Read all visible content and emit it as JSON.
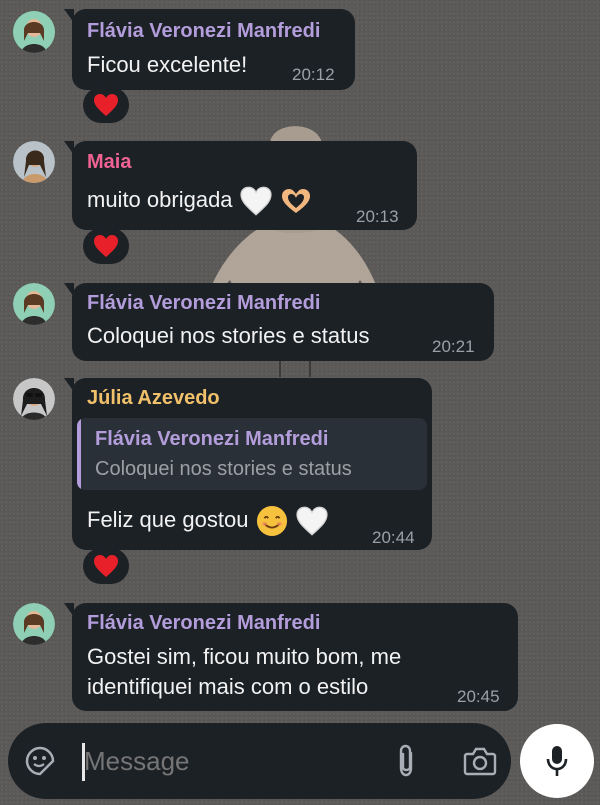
{
  "colors": {
    "bubble": "#1c2126",
    "name_purple": "#b39ddb",
    "name_pink": "#f06292",
    "name_gold": "#f0c06a",
    "time": "#9aa0a6"
  },
  "messages": [
    {
      "sender": "Flávia Veronezi Manfredi",
      "text": "Ficou excelente!",
      "time": "20:12",
      "reaction": "heart"
    },
    {
      "sender": "Maia",
      "text": "muito obrigada",
      "time": "20:13",
      "reaction": "heart"
    },
    {
      "sender": "Flávia Veronezi Manfredi",
      "text": "Coloquei nos stories e status",
      "time": "20:21"
    },
    {
      "sender": "Júlia Azevedo",
      "reply": {
        "sender": "Flávia Veronezi Manfredi",
        "text": "Coloquei nos stories e status"
      },
      "text": "Feliz que gostou",
      "time": "20:44",
      "reaction": "heart"
    },
    {
      "sender": "Flávia Veronezi Manfredi",
      "text_lines": [
        "Gostei sim, ficou muito bom, me",
        "identifiquei mais com o estilo"
      ],
      "time": "20:45"
    }
  ],
  "composer": {
    "placeholder": "Message",
    "icons": [
      "sticker-icon",
      "attach-icon",
      "camera-icon",
      "mic-icon"
    ]
  }
}
